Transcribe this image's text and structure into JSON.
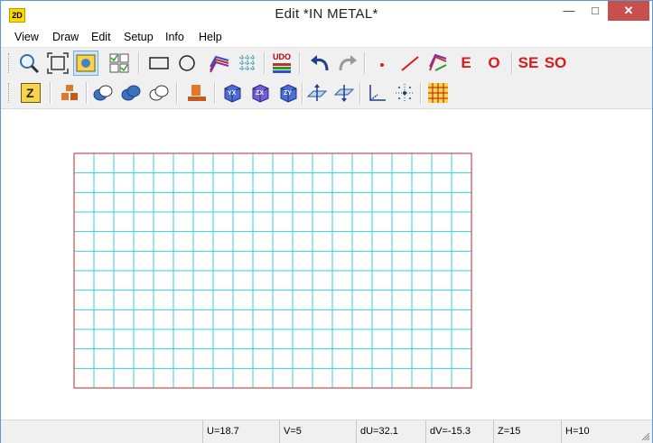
{
  "window": {
    "app_icon_label": "2D",
    "title": "Edit   *IN METAL*",
    "min_glyph": "—",
    "max_glyph": "□",
    "close_glyph": "✕"
  },
  "menu": [
    {
      "label": "View"
    },
    {
      "label": "Draw"
    },
    {
      "label": "Edit"
    },
    {
      "label": "Setup"
    },
    {
      "label": "Info"
    },
    {
      "label": "Help"
    }
  ],
  "toolbar1": {
    "udo_label": "UDO",
    "e_label": "E",
    "o_label": "O",
    "se_label": "SE",
    "so_label": "SO"
  },
  "toolbar2": {
    "z_label": "Z",
    "yx_label": "YX",
    "zx_label": "ZX",
    "zy_label": "ZY"
  },
  "grid": {
    "columns": 20,
    "rows": 12,
    "line_color": "#2fd3df",
    "border_color": "#c0262c"
  },
  "status": {
    "u": "U=18.7",
    "v": "V=5",
    "du": "dU=32.1",
    "dv": "dV=-15.3",
    "z": "Z=15",
    "h": "H=10"
  }
}
